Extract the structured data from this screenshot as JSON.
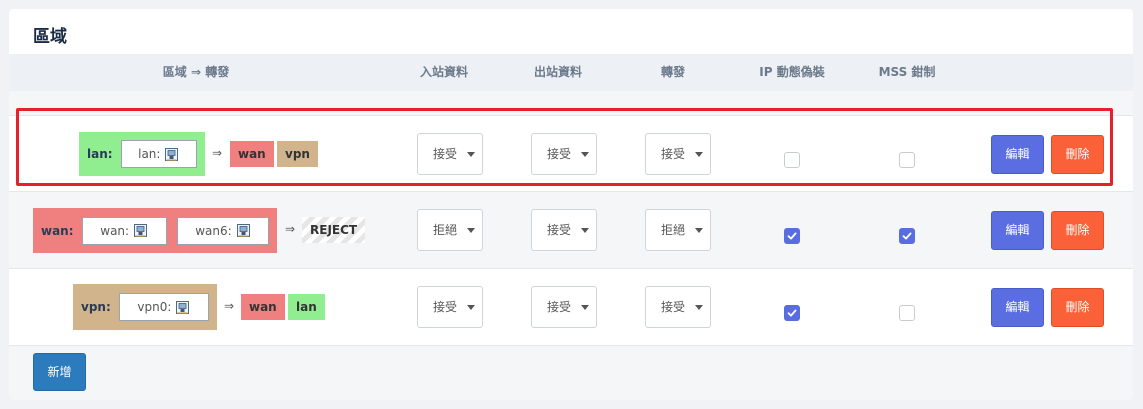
{
  "section": {
    "title": "區域"
  },
  "headers": {
    "zone": "區域 ⇒ 轉發",
    "input": "入站資料",
    "output": "出站資料",
    "forward": "轉發",
    "masq": "IP 動態偽裝",
    "mss": "MSS 鉗制"
  },
  "zones": [
    {
      "name": "lan:",
      "color": "#90ee90",
      "networks": [
        "lan:"
      ],
      "arrow": "⇒",
      "destinations": [
        {
          "label": "wan",
          "color": "#f08080"
        },
        {
          "label": "vpn",
          "color": "#d2b48c"
        }
      ],
      "input": "接受",
      "output": "接受",
      "forward": "接受",
      "masq": false,
      "mss": false,
      "edit": "編輯",
      "delete": "刪除"
    },
    {
      "name": "wan:",
      "color": "#f08080",
      "networks": [
        "wan:",
        "wan6:"
      ],
      "arrow": "⇒",
      "destinations": [
        {
          "label": "REJECT",
          "color": "striped"
        }
      ],
      "input": "拒絕",
      "output": "接受",
      "forward": "拒絕",
      "masq": true,
      "mss": true,
      "edit": "編輯",
      "delete": "刪除"
    },
    {
      "name": "vpn:",
      "color": "#d2b48c",
      "networks": [
        "vpn0:"
      ],
      "arrow": "⇒",
      "destinations": [
        {
          "label": "wan",
          "color": "#f08080"
        },
        {
          "label": "lan",
          "color": "#90ee90"
        }
      ],
      "input": "接受",
      "output": "接受",
      "forward": "接受",
      "masq": true,
      "mss": false,
      "edit": "編輯",
      "delete": "刪除"
    }
  ],
  "add_button": "新增",
  "icons": {
    "network": "network-port-icon",
    "caret": "caret-down-icon",
    "check": "check-icon"
  },
  "colors": {
    "accent": "#5b6ee1",
    "danger": "#fb6138",
    "add": "#2c7bbd",
    "highlight": "#e8202c"
  }
}
